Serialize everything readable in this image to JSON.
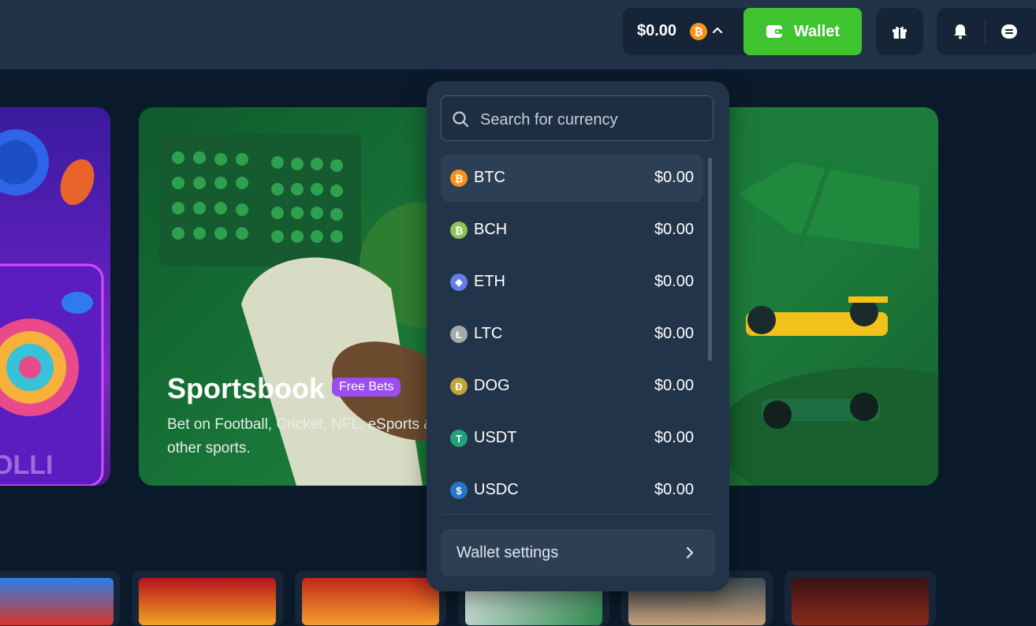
{
  "header": {
    "balance": "$0.00",
    "balance_coin_symbol": "₿",
    "wallet_label": "Wallet"
  },
  "banner": {
    "title": "Sportsbook",
    "badge": "Free Bets",
    "description": "Bet on Football, Cricket, NFL, eSports & other sports.",
    "left_banner_text": "OLLI"
  },
  "dropdown": {
    "search_placeholder": "Search for currency",
    "currencies": [
      {
        "code": "BTC",
        "value": "$0.00",
        "color": "#f7931a",
        "glyph": "₿"
      },
      {
        "code": "BCH",
        "value": "$0.00",
        "color": "#8dc351",
        "glyph": "₿"
      },
      {
        "code": "ETH",
        "value": "$0.00",
        "color": "#627eea",
        "glyph": "◆"
      },
      {
        "code": "LTC",
        "value": "$0.00",
        "color": "#a6a9aa",
        "glyph": "Ł"
      },
      {
        "code": "DOG",
        "value": "$0.00",
        "color": "#c2a633",
        "glyph": "Ð"
      },
      {
        "code": "USDT",
        "value": "$0.00",
        "color": "#26a17b",
        "glyph": "T"
      },
      {
        "code": "USDC",
        "value": "$0.00",
        "color": "#2775ca",
        "glyph": "$"
      }
    ],
    "settings_label": "Wallet settings"
  },
  "colors": {
    "accent_green": "#3fc32e",
    "badge_purple": "#9b4df0",
    "panel": "#223449"
  },
  "icons": [
    "chevron-up-icon",
    "wallet-icon",
    "gift-icon",
    "bell-icon",
    "chat-icon",
    "search-icon",
    "chevron-right-icon"
  ]
}
